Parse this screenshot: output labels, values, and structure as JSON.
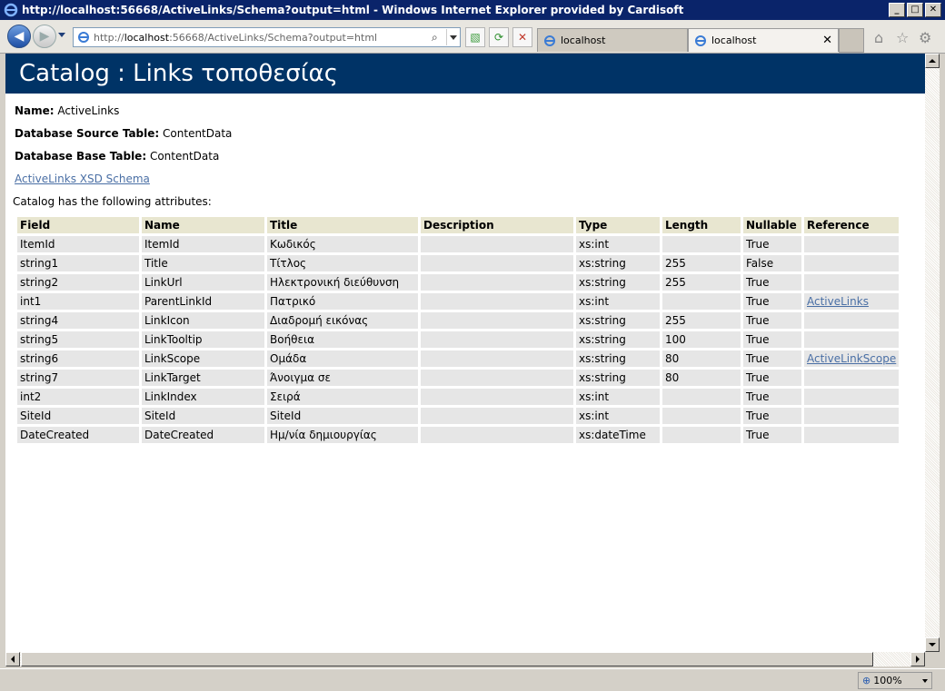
{
  "window": {
    "title": "http://localhost:56668/ActiveLinks/Schema?output=html - Windows Internet Explorer provided by Cardisoft"
  },
  "toolbar": {
    "address_gray": "http://",
    "address_host": "localhost",
    "address_rest": ":56668/ActiveLinks/Schema?output=html",
    "tabs": [
      {
        "label": "localhost"
      },
      {
        "label": "localhost"
      }
    ],
    "tab_close": "✕"
  },
  "page": {
    "header_title": "Catalog : Links τοποθεσίας",
    "name_label": "Name:",
    "name_value": "ActiveLinks",
    "source_label": "Database Source Table:",
    "source_value": "ContentData",
    "base_label": "Database Base Table:",
    "base_value": "ContentData",
    "xsd_link": "ActiveLinks XSD Schema",
    "attributes_intro": "Catalog has the following attributes:"
  },
  "table": {
    "headers": [
      "Field",
      "Name",
      "Title",
      "Description",
      "Type",
      "Length",
      "Nullable",
      "Reference"
    ],
    "rows": [
      [
        "ItemId",
        "ItemId",
        "Κωδικός",
        "",
        "xs:int",
        "",
        "True",
        ""
      ],
      [
        "string1",
        "Title",
        "Τίτλος",
        "",
        "xs:string",
        "255",
        "False",
        ""
      ],
      [
        "string2",
        "LinkUrl",
        "Ηλεκτρονική διεύθυνση",
        "",
        "xs:string",
        "255",
        "True",
        ""
      ],
      [
        "int1",
        "ParentLinkId",
        "Πατρικό",
        "",
        "xs:int",
        "",
        "True",
        "ActiveLinks"
      ],
      [
        "string4",
        "LinkIcon",
        "Διαδρομή εικόνας",
        "",
        "xs:string",
        "255",
        "True",
        ""
      ],
      [
        "string5",
        "LinkTooltip",
        "Βοήθεια",
        "",
        "xs:string",
        "100",
        "True",
        ""
      ],
      [
        "string6",
        "LinkScope",
        "Ομάδα",
        "",
        "xs:string",
        "80",
        "True",
        "ActiveLinkScope"
      ],
      [
        "string7",
        "LinkTarget",
        "Άνοιγμα σε",
        "",
        "xs:string",
        "80",
        "True",
        ""
      ],
      [
        "int2",
        "LinkIndex",
        "Σειρά",
        "",
        "xs:int",
        "",
        "True",
        ""
      ],
      [
        "SiteId",
        "SiteId",
        "SiteId",
        "",
        "xs:int",
        "",
        "True",
        ""
      ],
      [
        "DateCreated",
        "DateCreated",
        "Ημ/νία δημιουργίας",
        "",
        "xs:dateTime",
        "",
        "True",
        ""
      ]
    ]
  },
  "status": {
    "zoom": "100%"
  },
  "colors": {
    "header_bg": "#003366",
    "link": "#4a6fa5",
    "th_bg": "#e8e6d0",
    "td_bg": "#e6e6e6"
  }
}
